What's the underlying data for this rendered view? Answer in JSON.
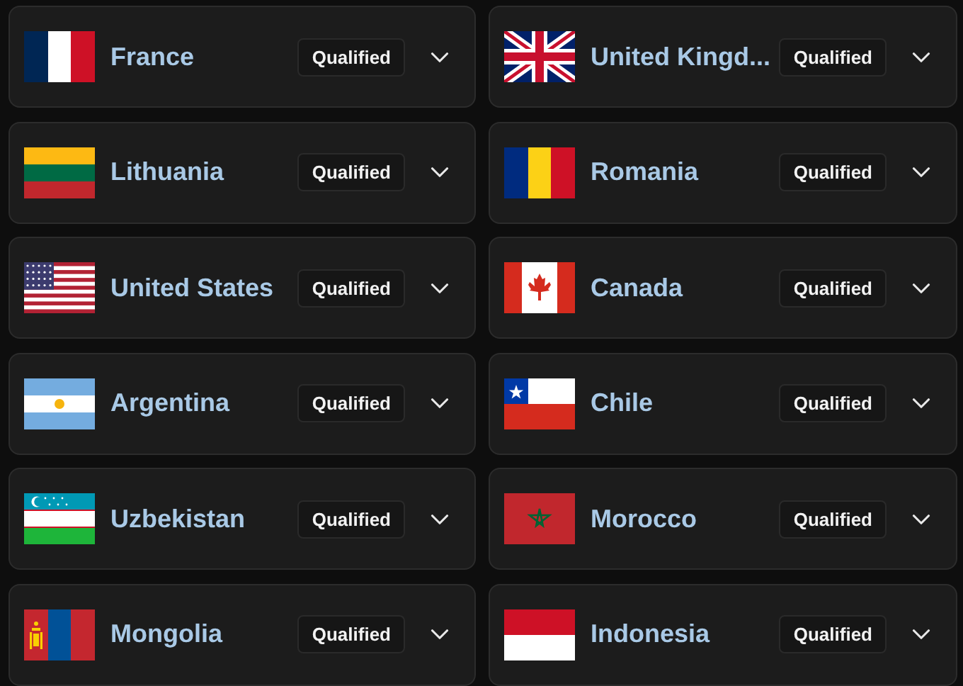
{
  "countries": [
    {
      "name": "France",
      "kind": "fr",
      "status": "Qualified"
    },
    {
      "name": "United Kingd...",
      "kind": "gb",
      "status": "Qualified"
    },
    {
      "name": "Lithuania",
      "kind": "lt",
      "status": "Qualified"
    },
    {
      "name": "Romania",
      "kind": "ro",
      "status": "Qualified"
    },
    {
      "name": "United States",
      "kind": "us",
      "status": "Qualified"
    },
    {
      "name": "Canada",
      "kind": "ca",
      "status": "Qualified"
    },
    {
      "name": "Argentina",
      "kind": "ar",
      "status": "Qualified"
    },
    {
      "name": "Chile",
      "kind": "cl",
      "status": "Qualified"
    },
    {
      "name": "Uzbekistan",
      "kind": "uz",
      "status": "Qualified"
    },
    {
      "name": "Morocco",
      "kind": "ma",
      "status": "Qualified"
    },
    {
      "name": "Mongolia",
      "kind": "mn",
      "status": "Qualified"
    },
    {
      "name": "Indonesia",
      "kind": "id",
      "status": "Qualified"
    }
  ]
}
